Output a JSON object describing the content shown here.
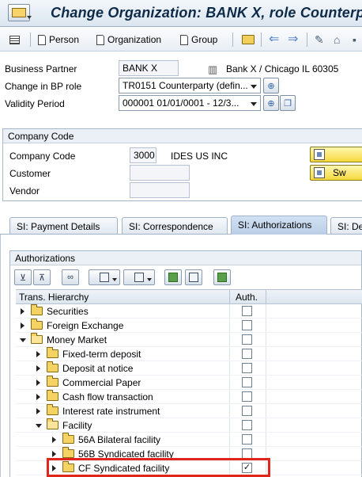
{
  "window": {
    "title": "Change Organization: BANK X, role Counterparty"
  },
  "toolbar": {
    "person_label": "Person",
    "organization_label": "Organization",
    "group_label": "Group"
  },
  "header": {
    "business_partner_label": "Business Partner",
    "business_partner_value": "BANK X",
    "business_partner_text": "Bank X / Chicago IL 60305",
    "bp_role_label": "Change in BP role",
    "bp_role_value": "TR0151 Counterparty (defin...",
    "validity_label": "Validity Period",
    "validity_value": "000001 01/01/0001 - 12/3..."
  },
  "company_code": {
    "section_title": "Company Code",
    "company_code_label": "Company Code",
    "company_code_value": "3000",
    "company_code_text": "IDES US INC",
    "customer_label": "Customer",
    "customer_value": "",
    "vendor_label": "Vendor",
    "vendor_value": "",
    "button_2_label": "Sw"
  },
  "tabs": [
    {
      "label": "SI: Payment Details",
      "active": false
    },
    {
      "label": "SI: Correspondence",
      "active": false
    },
    {
      "label": "SI: Authorizations",
      "active": true
    },
    {
      "label": "SI: De",
      "active": false
    }
  ],
  "authorizations": {
    "section_title": "Authorizations",
    "col_hierarchy": "Trans. Hierarchy",
    "col_auth": "Auth.",
    "rows": [
      {
        "label": "Securities",
        "level": 0,
        "expanded": false,
        "checked": false
      },
      {
        "label": "Foreign Exchange",
        "level": 0,
        "expanded": false,
        "checked": false
      },
      {
        "label": "Money Market",
        "level": 0,
        "expanded": true,
        "checked": false
      },
      {
        "label": "Fixed-term deposit",
        "level": 1,
        "expanded": false,
        "checked": false
      },
      {
        "label": "Deposit at notice",
        "level": 1,
        "expanded": false,
        "checked": false
      },
      {
        "label": "Commercial Paper",
        "level": 1,
        "expanded": false,
        "checked": false
      },
      {
        "label": "Cash flow transaction",
        "level": 1,
        "expanded": false,
        "checked": false
      },
      {
        "label": "Interest rate instrument",
        "level": 1,
        "expanded": false,
        "checked": false
      },
      {
        "label": "Facility",
        "level": 1,
        "expanded": true,
        "checked": false
      },
      {
        "label": "56A  Bilateral facility",
        "level": 2,
        "expanded": false,
        "checked": false
      },
      {
        "label": "56B  Syndicated facility",
        "level": 2,
        "expanded": false,
        "checked": false
      },
      {
        "label": "CF   Syndicated facility",
        "level": 2,
        "expanded": false,
        "checked": true
      }
    ]
  },
  "colors": {
    "title_text": "#0d2a48",
    "highlight": "#e0261b",
    "yellow_button": "#f5d93c"
  }
}
